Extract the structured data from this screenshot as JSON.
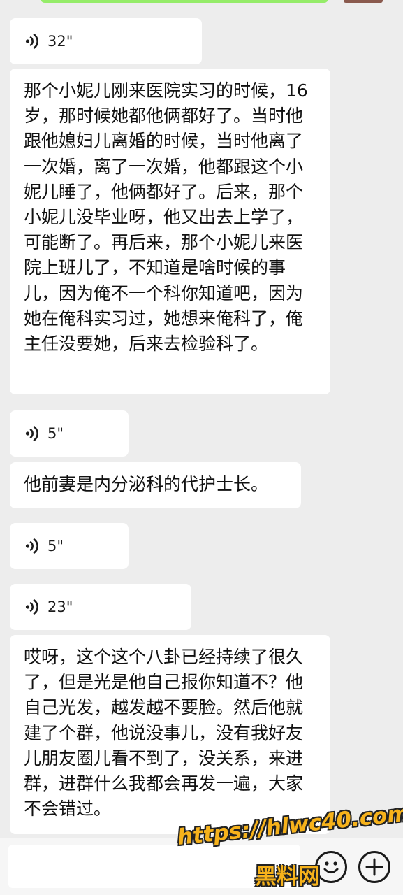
{
  "messages": [
    {
      "type": "voice",
      "duration": "32\""
    },
    {
      "type": "text",
      "text": "那个小妮儿刚来医院实习的时候，16岁，那时候她都他俩都好了。当时他跟他媳妇儿离婚的时候，当时他离了一次婚，离了一次婚，他都跟这个小妮儿睡了，他俩都好了。后来，那个小妮儿没毕业呀，他又出去上学了，可能断了。再后来，那个小妮儿来医院上班儿了，不知道是啥时候的事儿，因为俺不一个科你知道吧，因为她在俺科实习过，她想来俺科了，俺主任没要她，后来去检验科了。"
    },
    {
      "type": "voice",
      "duration": "5\""
    },
    {
      "type": "text",
      "text": "他前妻是内分泌科的代护士长。"
    },
    {
      "type": "voice",
      "duration": "5\""
    },
    {
      "type": "voice",
      "duration": "23\""
    },
    {
      "type": "text",
      "text": "哎呀，这个这个八卦已经持续了很久了，但是光是他自己报你知道不？他自己光发，越发越不要脸。然后他就建了个群，他说没事儿，没有我好友儿朋友圈儿看不到了，没关系，来进群，进群什么我都会再发一遍，大家不会错过。"
    }
  ],
  "watermark": {
    "url": "https://hlwc40.com",
    "name": "黑料网"
  },
  "icons": {
    "voice": "voice-wave-icon",
    "emoji": "emoji-icon",
    "plus": "plus-icon"
  }
}
